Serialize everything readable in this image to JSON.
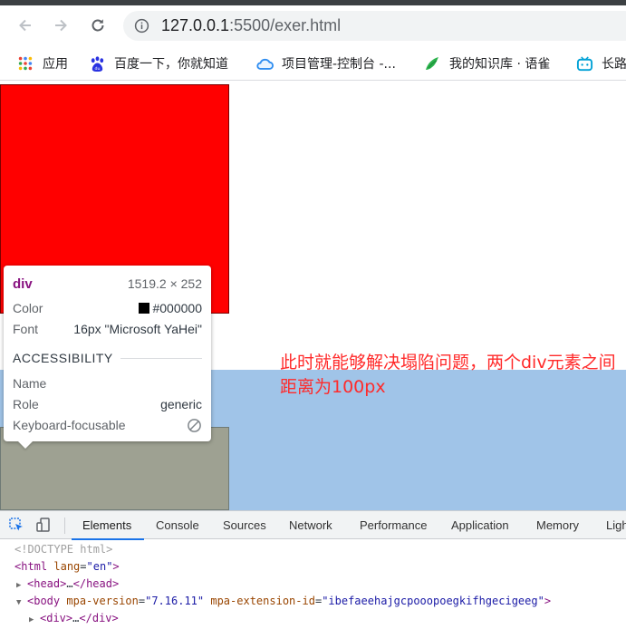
{
  "browser": {
    "url_host": "127.0.0.1",
    "url_rest": ":5500/exer.html",
    "bookmarks": [
      {
        "label": "应用",
        "icon": "apps-grid-icon"
      },
      {
        "label": "百度一下，你就知道",
        "icon": "baidu-paw-icon"
      },
      {
        "label": "项目管理-控制台 -...",
        "icon": "cloud-icon"
      },
      {
        "label": "我的知识库 · 语雀",
        "icon": "yuque-bird-icon"
      },
      {
        "label": "长路",
        "icon": "bilibili-tv-icon"
      }
    ]
  },
  "tooltip": {
    "tag": "div",
    "dimensions": "1519.2 × 252",
    "color_label": "Color",
    "color_value": "#000000",
    "font_label": "Font",
    "font_value": "16px \"Microsoft YaHei\"",
    "section": "ACCESSIBILITY",
    "name_label": "Name",
    "role_label": "Role",
    "role_value": "generic",
    "focusable_label": "Keyboard-focusable"
  },
  "page": {
    "annotation": "此时就能够解决塌陷问题，两个div元素之间距离为100px",
    "colors": {
      "red_box": "#ff0000",
      "blue_band": "#a0c4e8",
      "gray_box": "#9ea192",
      "annotation": "#ff2a2a"
    }
  },
  "devtools": {
    "tabs": [
      "Elements",
      "Console",
      "Sources",
      "Network",
      "Performance",
      "Application",
      "Memory",
      "Ligh"
    ],
    "active_tab": "Elements",
    "dom": {
      "doctype": "<!DOCTYPE html>",
      "html_tag": "html",
      "html_attr": "lang",
      "html_val": "\"en\"",
      "head_tag": "head",
      "body_tag": "body",
      "body_attr1": "mpa-version",
      "body_val1": "\"7.16.11\"",
      "body_attr2": "mpa-extension-id",
      "body_val2": "\"ibefaeehajgcpooopoegkifhgecigeeg\"",
      "div_tag": "div",
      "ellipsis": "…"
    }
  }
}
